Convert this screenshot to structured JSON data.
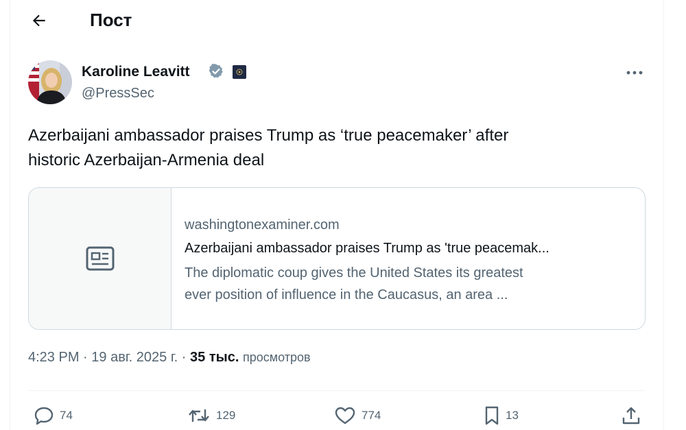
{
  "header": {
    "back_icon": "arrow-left-icon",
    "title": "Пост"
  },
  "author": {
    "name": "Karoline Leavitt",
    "handle": "@PressSec",
    "verified_icon": "verified-badge-icon",
    "affiliate_icon": "government-affiliate-badge",
    "verified_color": "#829aab"
  },
  "more_icon": "more-horizontal-icon",
  "tweet": {
    "line1": "Azerbaijani ambassador praises Trump as ‘true peacemaker’ after",
    "line2": "historic Azerbaijan-Armenia deal"
  },
  "card": {
    "thumb_icon": "news-article-icon",
    "domain": "washingtonexaminer.com",
    "title": "Azerbaijani ambassador praises Trump as 'true peacemak...",
    "desc_line1": "The diplomatic coup gives the United States its greatest",
    "desc_line2": "ever position of influence in the Caucasus, an area ..."
  },
  "meta": {
    "time": "4:23 PM",
    "sep1": " · ",
    "date": "19 авг. 2025 г.",
    "sep2": " · ",
    "views_count": "35 тыс.",
    "views_label": "просмотров"
  },
  "actions": {
    "replies": "74",
    "reposts": "129",
    "likes": "774",
    "bookmarks": "13",
    "reply_icon": "reply-icon",
    "repost_icon": "repost-icon",
    "like_icon": "heart-icon",
    "bookmark_icon": "bookmark-icon",
    "share_icon": "share-icon"
  },
  "colors": {
    "text_primary": "#0f1419",
    "text_secondary": "#536471",
    "border": "#cfd9de"
  }
}
